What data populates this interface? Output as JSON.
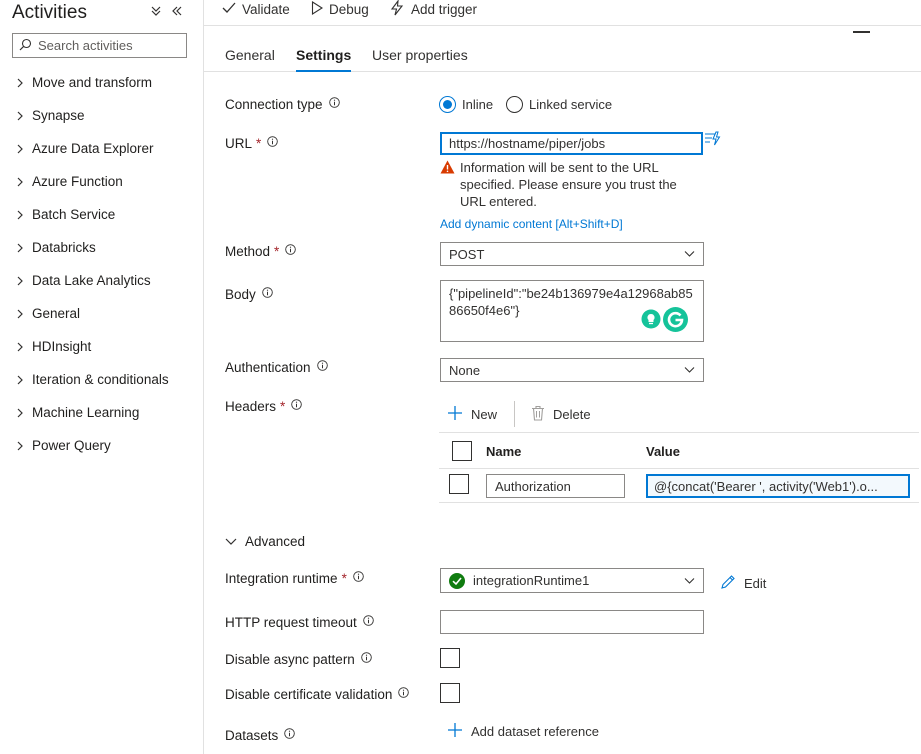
{
  "sidebar": {
    "title": "Activities",
    "search_placeholder": "Search activities",
    "items": [
      {
        "label": "Move and transform"
      },
      {
        "label": "Synapse"
      },
      {
        "label": "Azure Data Explorer"
      },
      {
        "label": "Azure Function"
      },
      {
        "label": "Batch Service"
      },
      {
        "label": "Databricks"
      },
      {
        "label": "Data Lake Analytics"
      },
      {
        "label": "General"
      },
      {
        "label": "HDInsight"
      },
      {
        "label": "Iteration & conditionals"
      },
      {
        "label": "Machine Learning"
      },
      {
        "label": "Power Query"
      }
    ]
  },
  "toolbar": {
    "validate": "Validate",
    "debug": "Debug",
    "add_trigger": "Add trigger"
  },
  "tabs": {
    "general": "General",
    "settings": "Settings",
    "user_properties": "User properties",
    "active": "Settings"
  },
  "form": {
    "connection_type": {
      "label": "Connection type",
      "options": [
        "Inline",
        "Linked service"
      ],
      "selected": "Inline"
    },
    "url": {
      "label": "URL",
      "value": "https://hostname/piper/jobs",
      "warning": "Information will be sent to the URL specified. Please ensure you trust the URL entered.",
      "dynamic_link": "Add dynamic content [Alt+Shift+D]"
    },
    "method": {
      "label": "Method",
      "value": "POST"
    },
    "body": {
      "label": "Body",
      "value": "{\"pipelineId\":\"be24b136979e4a12968ab8586650f4e6\"}"
    },
    "authentication": {
      "label": "Authentication",
      "value": "None"
    },
    "headers": {
      "label": "Headers",
      "new_label": "New",
      "delete_label": "Delete",
      "col_name": "Name",
      "col_value": "Value",
      "rows": [
        {
          "name": "Authorization",
          "value": "@{concat('Bearer ', activity('Web1').o..."
        }
      ]
    },
    "advanced": {
      "label": "Advanced",
      "integration_runtime": {
        "label": "Integration runtime",
        "value": "integrationRuntime1",
        "edit_label": "Edit"
      },
      "http_timeout": {
        "label": "HTTP request timeout",
        "value": ""
      },
      "disable_async": {
        "label": "Disable async pattern",
        "checked": false
      },
      "disable_cert": {
        "label": "Disable certificate validation",
        "checked": false
      },
      "datasets": {
        "label": "Datasets",
        "add_label": "Add dataset reference"
      }
    }
  },
  "colors": {
    "accent": "#0078d4",
    "required": "#a4262c",
    "warning": "#d83b01",
    "success": "#107c10",
    "grammarly": "#15c39a"
  }
}
